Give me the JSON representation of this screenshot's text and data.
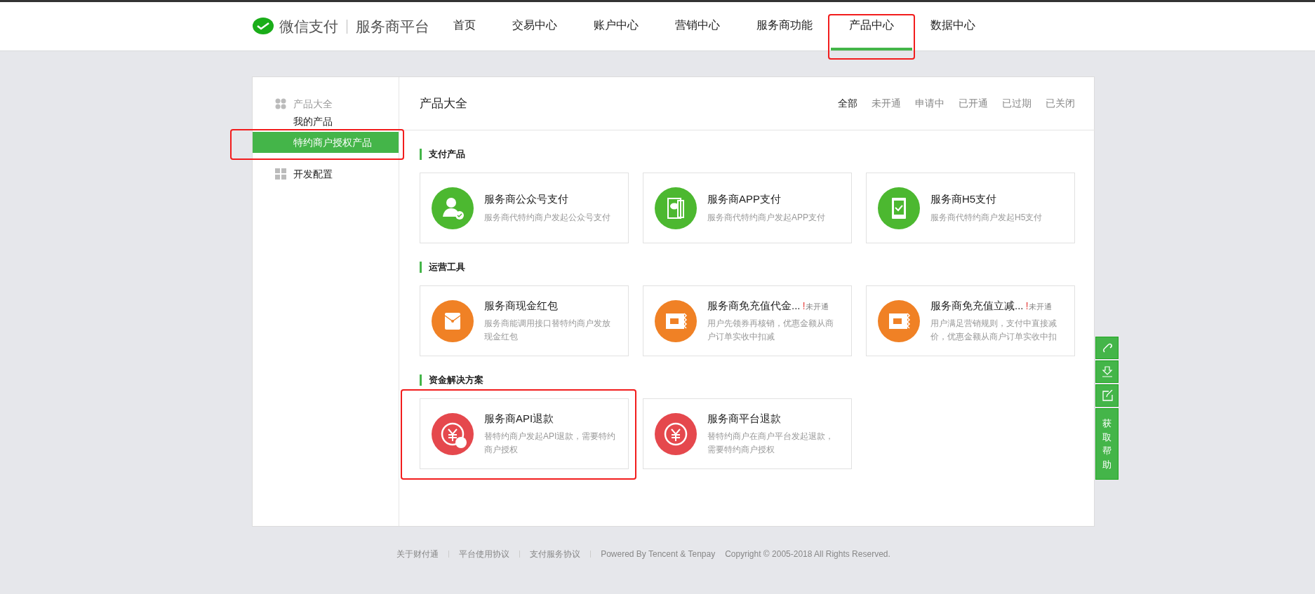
{
  "header": {
    "logo_brand": "微信支付",
    "logo_product": "服务商平台",
    "nav": [
      {
        "label": "首页",
        "selected": false,
        "highlighted": false
      },
      {
        "label": "交易中心",
        "selected": false,
        "highlighted": false
      },
      {
        "label": "账户中心",
        "selected": false,
        "highlighted": false
      },
      {
        "label": "营销中心",
        "selected": false,
        "highlighted": false
      },
      {
        "label": "服务商功能",
        "selected": false,
        "highlighted": false
      },
      {
        "label": "产品中心",
        "selected": true,
        "highlighted": true
      },
      {
        "label": "数据中心",
        "selected": false,
        "highlighted": false
      }
    ]
  },
  "sidebar": {
    "groups": [
      {
        "label": "产品大全",
        "kind": "products",
        "children": [
          {
            "label": "我的产品",
            "selected": false,
            "highlighted": false
          },
          {
            "label": "特约商户授权产品",
            "selected": true,
            "highlighted": true
          }
        ]
      },
      {
        "label": "开发配置",
        "kind": "config"
      }
    ]
  },
  "main": {
    "title": "产品大全",
    "filters": [
      {
        "label": "全部",
        "selected": true
      },
      {
        "label": "未开通",
        "selected": false
      },
      {
        "label": "申请中",
        "selected": false
      },
      {
        "label": "已开通",
        "selected": false
      },
      {
        "label": "已过期",
        "selected": false
      },
      {
        "label": "已关闭",
        "selected": false
      }
    ],
    "sections": [
      {
        "title": "支付产品",
        "cards": [
          {
            "kind": "official-account",
            "title": "服务商公众号支付",
            "description": "服务商代特约商户发起公众号支付",
            "highlighted": false
          },
          {
            "kind": "app",
            "title": "服务商APP支付",
            "description": "服务商代特约商户发起APP支付",
            "highlighted": false
          },
          {
            "kind": "h5",
            "title": "服务商H5支付",
            "description": "服务商代特约商户发起H5支付",
            "highlighted": false
          }
        ]
      },
      {
        "title": "运营工具",
        "cards": [
          {
            "kind": "red-packet",
            "title": "服务商现金红包",
            "description": "服务商能调用接口替特约商户发放现金红包",
            "highlighted": false
          },
          {
            "kind": "voucher",
            "title": "服务商免充值代金...",
            "status_mark": "!",
            "status": "未开通",
            "description": "用户先领券再核销，优惠金额从商户订单实收中扣减",
            "highlighted": false
          },
          {
            "kind": "discount",
            "title": "服务商免充值立减...",
            "status_mark": "!",
            "status": "未开通",
            "description": "用户满足营销规则，支付中直接减价，优惠金额从商户订单实收中扣",
            "highlighted": false
          }
        ]
      },
      {
        "title": "资金解决方案",
        "cards": [
          {
            "kind": "api-refund",
            "title": "服务商API退款",
            "description": "替特约商户发起API退款，需要特约商户授权",
            "highlighted": true
          },
          {
            "kind": "platform-refund",
            "title": "服务商平台退款",
            "description": "替特约商户在商户平台发起退款，需要特约商户授权",
            "highlighted": false
          }
        ]
      }
    ]
  },
  "footer": {
    "links": [
      "关于财付通",
      "平台使用协议",
      "支付服务协议"
    ],
    "powered": "Powered By Tencent & Tenpay",
    "copyright": "Copyright © 2005-2018 All Rights Reserved."
  },
  "float_tools": {
    "buttons": [
      {
        "kind": "link"
      },
      {
        "kind": "download"
      },
      {
        "kind": "edit"
      }
    ],
    "help": "获取帮助"
  }
}
